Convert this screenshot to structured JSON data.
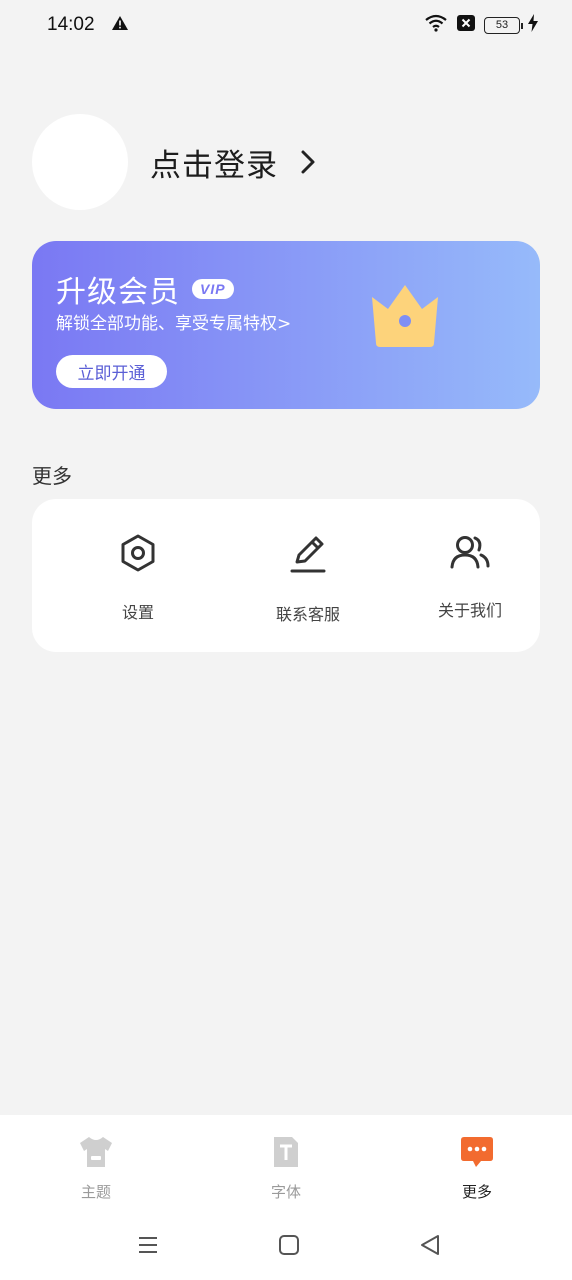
{
  "status_bar": {
    "time": "14:02",
    "battery": "53",
    "icons": [
      "warning-icon",
      "wifi-icon",
      "notification-close-icon",
      "battery-icon",
      "charging-icon"
    ]
  },
  "profile": {
    "login_label": "点击登录"
  },
  "vip": {
    "title": "升级会员",
    "badge": "VIP",
    "subtitle": "解锁全部功能、享受专属特权>",
    "button": "立即开通",
    "colors": {
      "gradient_start": "#7a78f3",
      "gradient_end": "#96bafa",
      "crown": "#fdd37b"
    }
  },
  "more": {
    "title": "更多",
    "items": [
      {
        "label": "设置",
        "icon": "settings-icon"
      },
      {
        "label": "联系客服",
        "icon": "edit-icon"
      },
      {
        "label": "关于我们",
        "icon": "users-icon"
      }
    ]
  },
  "bottom_nav": {
    "items": [
      {
        "label": "主题",
        "icon": "shirt-icon",
        "active": false
      },
      {
        "label": "字体",
        "icon": "font-icon",
        "active": false
      },
      {
        "label": "更多",
        "icon": "chat-more-icon",
        "active": true
      }
    ],
    "accent": "#f26b2f"
  }
}
